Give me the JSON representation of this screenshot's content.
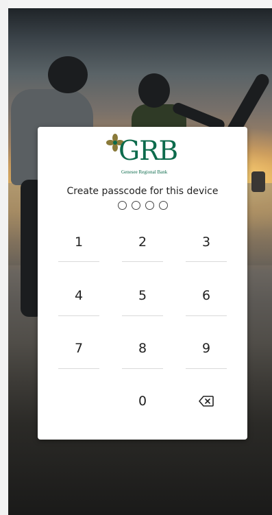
{
  "brand": {
    "logo_letters": "GRB",
    "logo_subtitle": "Genesee Regional Bank",
    "color": "#0d6b4c"
  },
  "passcode": {
    "prompt": "Create passcode for this device",
    "digits_entered": 0,
    "total_digits": 4
  },
  "keypad": {
    "keys": [
      "1",
      "2",
      "3",
      "4",
      "5",
      "6",
      "7",
      "8",
      "9",
      "0"
    ],
    "backspace_icon": "backspace-icon"
  }
}
